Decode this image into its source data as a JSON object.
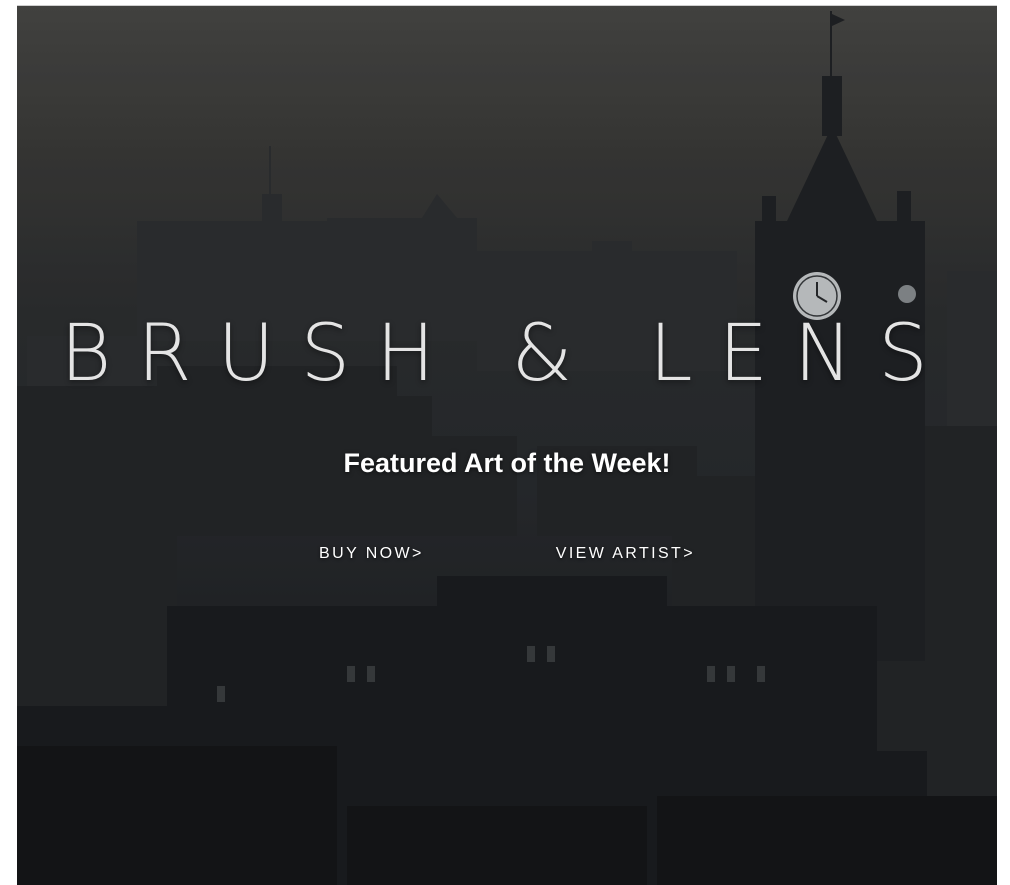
{
  "hero": {
    "brand_title": "BRUSH & LENS",
    "tagline": "Featured Art of the Week!",
    "buy_now_label": "BUY NOW>",
    "view_artist_label": "VIEW ARTIST>"
  },
  "colors": {
    "sky": "#4a4a48",
    "buildings": "#1f2124",
    "text": "#ffffff"
  },
  "icons": {
    "hero_image": "city-skyline-image"
  }
}
